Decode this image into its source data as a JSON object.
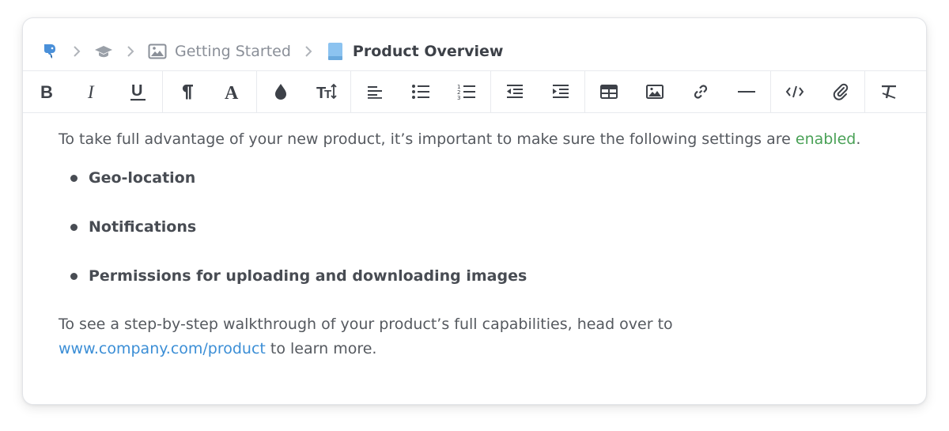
{
  "breadcrumb": {
    "items": [
      {
        "icon": "mascot-icon",
        "label": ""
      },
      {
        "icon": "graduation-cap-icon",
        "label": ""
      },
      {
        "icon": "image-icon",
        "label": "Getting Started"
      },
      {
        "icon": "book-icon",
        "label": "Product Overview"
      }
    ]
  },
  "toolbar": {
    "groups": [
      [
        "bold-icon",
        "italic-icon",
        "underline-icon"
      ],
      [
        "paragraph-icon",
        "font-color-icon"
      ],
      [
        "fill-color-icon",
        "font-size-icon"
      ],
      [
        "align-left-icon",
        "bullet-list-icon",
        "numbered-list-icon"
      ],
      [
        "outdent-icon",
        "indent-icon"
      ],
      [
        "table-icon",
        "image-icon",
        "link-icon",
        "horizontal-rule-icon"
      ],
      [
        "code-icon",
        "attachment-icon"
      ],
      [
        "clear-format-icon"
      ]
    ]
  },
  "content": {
    "intro_before": "To take full advantage of your new product, it’s important to make sure the following settings are ",
    "intro_highlight": "enabled",
    "intro_after": ".",
    "features": [
      "Geo-location",
      "Notifications",
      "Permissions for uploading and downloading images"
    ],
    "outro_before": "To see a step-by-step walkthrough of your product’s full capabilities, head over to",
    "outro_link": "www.company.com/product",
    "outro_after": " to learn more."
  },
  "colors": {
    "highlight": "#4aa157",
    "link": "#3b8ed6",
    "book": "#8cc3f0",
    "mascot": "#4a90d9"
  }
}
